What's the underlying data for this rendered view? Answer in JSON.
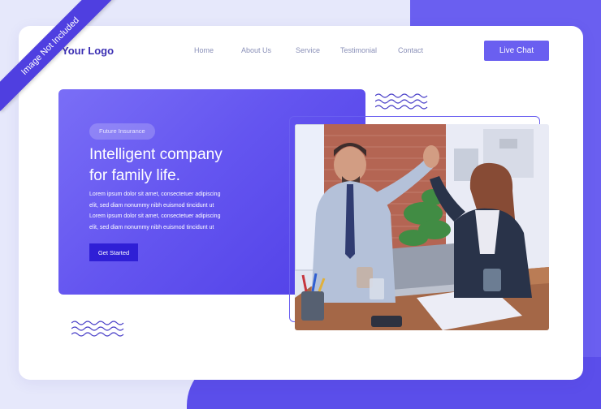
{
  "ribbon": "Image Not Included",
  "logo": "Your Logo",
  "nav": [
    "Home",
    "About Us",
    "Service",
    "Testimonial",
    "Contact"
  ],
  "live_chat": "Live Chat",
  "hero": {
    "tag": "Future Insurance",
    "title_line1": "Intelligent company",
    "title_line2": "for family life.",
    "body": [
      "Lorem ipsum dolor sit amet, consectetuer adipiscing",
      "elit, sed diam nonummy nibh euismod tincidunt ut",
      "Lorem ipsum dolor sit amet, consectetuer adipiscing",
      "elit, sed diam nonummy nibh euismod tincidunt ut"
    ],
    "cta": "Get Started"
  },
  "colors": {
    "accent": "#6a5ff0",
    "dark_accent": "#2f1fd6",
    "logo": "#3b2fb3",
    "nav_text": "#8a90b8"
  }
}
